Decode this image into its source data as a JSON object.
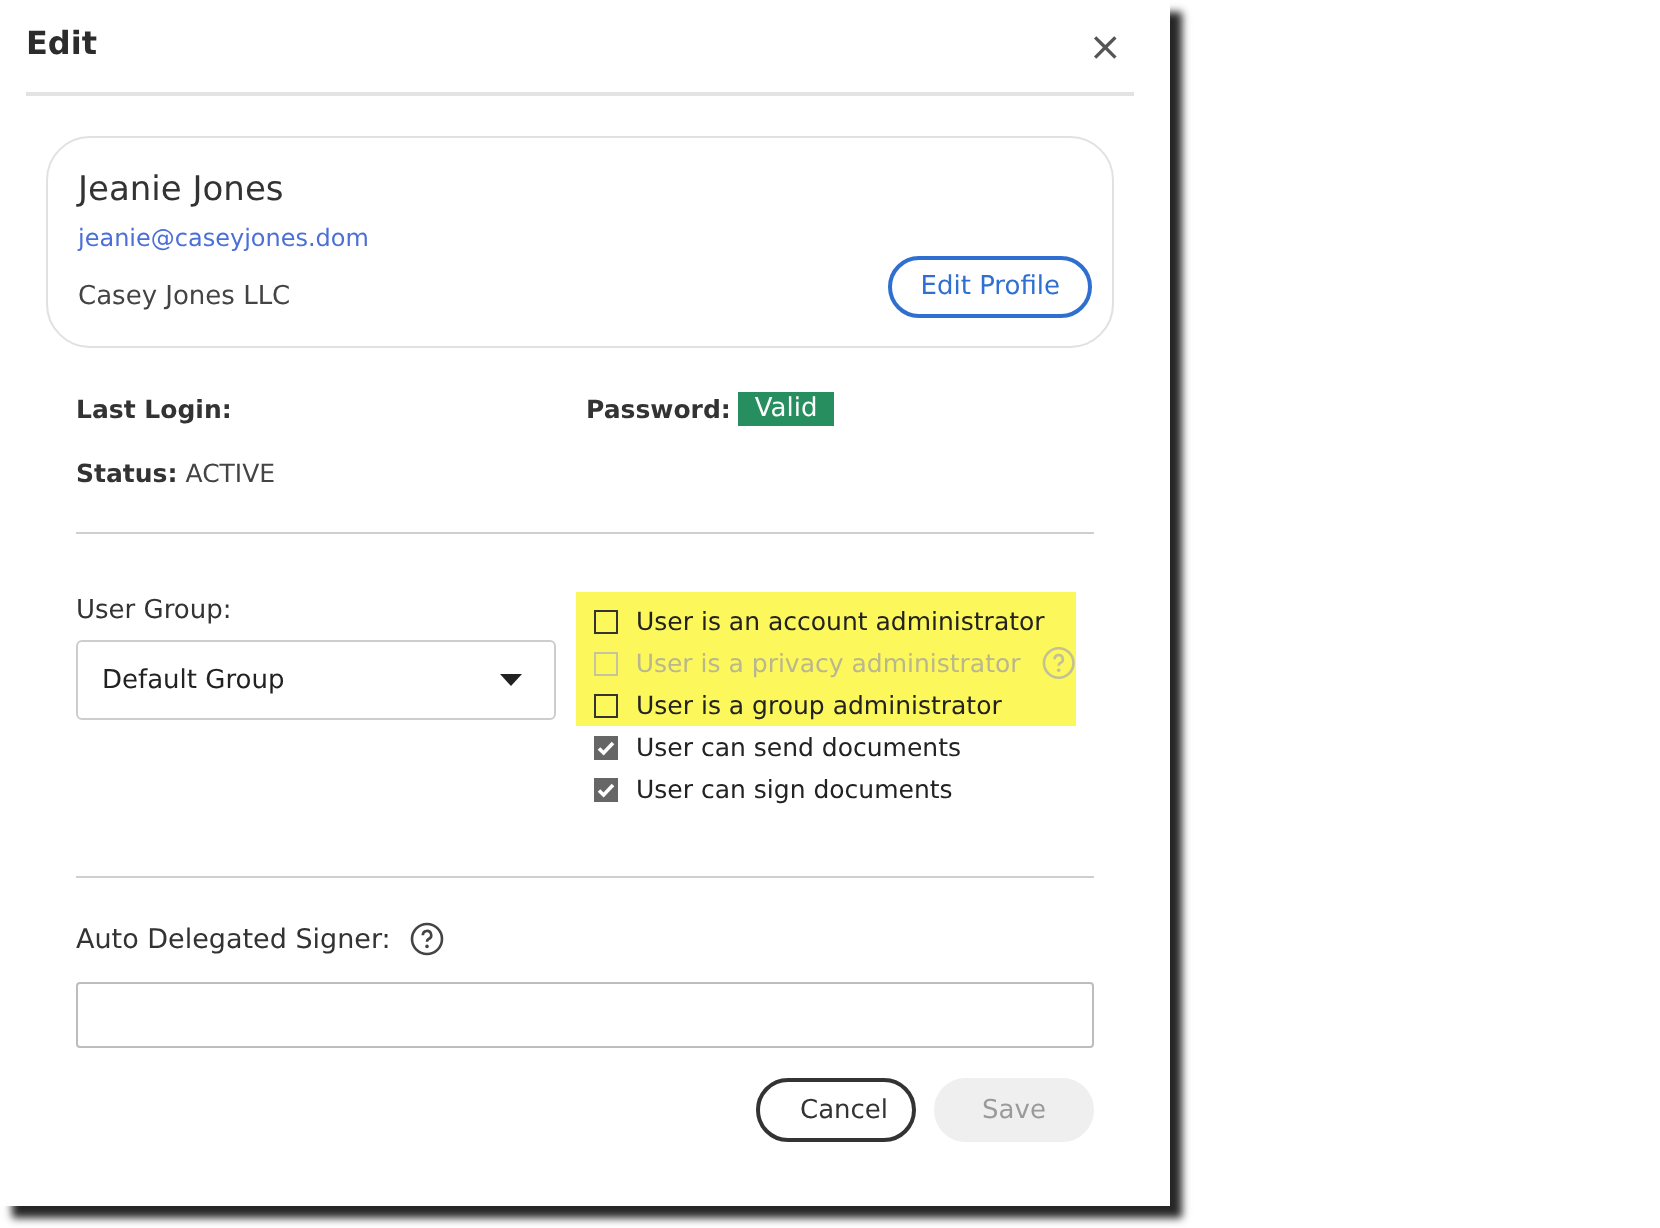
{
  "dialog": {
    "title": "Edit",
    "close": "×"
  },
  "profile": {
    "name": "Jeanie Jones",
    "email": "jeanie@caseyjones.dom",
    "company": "Casey Jones LLC",
    "button": "Edit Profile"
  },
  "last_login": {
    "label": "Last Login:"
  },
  "password": {
    "label": "Password:",
    "badge": "Valid"
  },
  "status": {
    "label": "Status:",
    "value": "ACTIVE"
  },
  "user_group": {
    "label": "User Group:",
    "value": "Default Group"
  },
  "permissions": [
    {
      "label": "User is an account administrator",
      "checked": false,
      "disabled": false,
      "highlighted": true,
      "help": false
    },
    {
      "label": "User is a privacy administrator",
      "checked": false,
      "disabled": true,
      "highlighted": true,
      "help": true
    },
    {
      "label": "User is a group administrator",
      "checked": false,
      "disabled": false,
      "highlighted": true,
      "help": false
    },
    {
      "label": "User can send documents",
      "checked": true,
      "disabled": false,
      "highlighted": false,
      "help": false
    },
    {
      "label": "User can sign documents",
      "checked": true,
      "disabled": false,
      "highlighted": false,
      "help": false
    }
  ],
  "delegated_signer": {
    "label": "Auto Delegated Signer:"
  },
  "buttons": [
    {
      "label": "Cancel",
      "disabled": false
    },
    {
      "label": "Save",
      "disabled": true
    }
  ]
}
